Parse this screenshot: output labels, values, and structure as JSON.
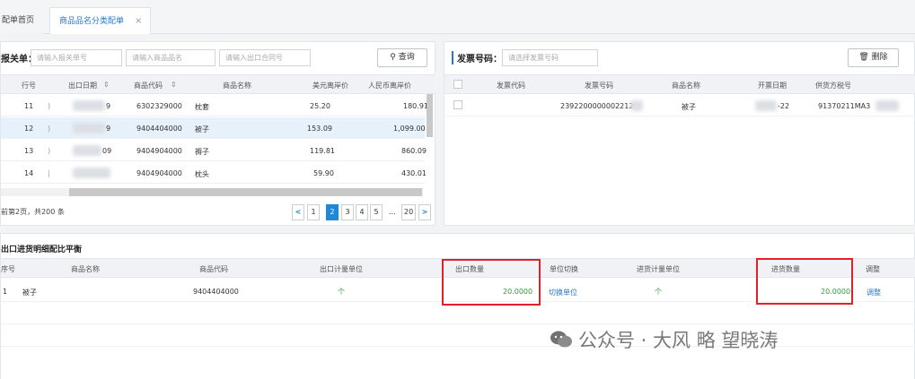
{
  "tabs": {
    "home": "配单首页",
    "active": "商品品名分类配单",
    "close": "×"
  },
  "left": {
    "title": "报关单：",
    "placeholders": [
      "请输入报关单号",
      "请输入商品品名",
      "请输入出口合同号"
    ],
    "query_label": "查询",
    "headers": [
      "行号",
      "出口日期",
      "商品代码",
      "商品名称",
      "美元离岸价",
      "人民币离岸价"
    ],
    "rows": [
      {
        "idx": "11",
        "date_tail": "9",
        "code": "6302329000",
        "name": "枕套",
        "usd": "25.20",
        "cny": "180.91"
      },
      {
        "idx": "12",
        "date_tail": "9",
        "code": "9404404000",
        "name": "被子",
        "usd": "153.09",
        "cny": "1,099.00"
      },
      {
        "idx": "13",
        "date_tail": "09",
        "code": "9404904000",
        "name": "褥子",
        "usd": "119.81",
        "cny": "860.09"
      },
      {
        "idx": "14",
        "date_tail": "",
        "code": "9404904000",
        "name": "枕头",
        "usd": "59.90",
        "cny": "430.01"
      }
    ],
    "pager_text": "前第2页，共200 条",
    "pages": [
      "1",
      "2",
      "3",
      "4",
      "5",
      "...",
      "20"
    ],
    "prev": "<",
    "next": ">"
  },
  "right": {
    "title": "发票号码：",
    "placeholder": "请选择发票号码",
    "delete_label": "删除",
    "headers": [
      "发票代码",
      "发票号码",
      "商品名称",
      "开票日期",
      "供货方税号"
    ],
    "rows": [
      {
        "code": "",
        "number": "2392200000002212",
        "name": "被子",
        "date": "-22",
        "tax": "91370211MA3"
      }
    ]
  },
  "bottom": {
    "title": "出口进货明细配比平衡",
    "headers": [
      "序号",
      "商品名称",
      "商品代码",
      "出口计量单位",
      "出口数量",
      "单位切换",
      "进货计量单位",
      "进货数量",
      "调整"
    ],
    "row": {
      "idx": "1",
      "name": "被子",
      "code": "9404404000",
      "export_unit": "个",
      "export_qty": "20.0000",
      "switch": "切换单位",
      "import_unit": "个",
      "import_qty": "20.0000",
      "adjust": "调整"
    }
  },
  "watermark": "公众号 · 大风 略 望晓涛"
}
